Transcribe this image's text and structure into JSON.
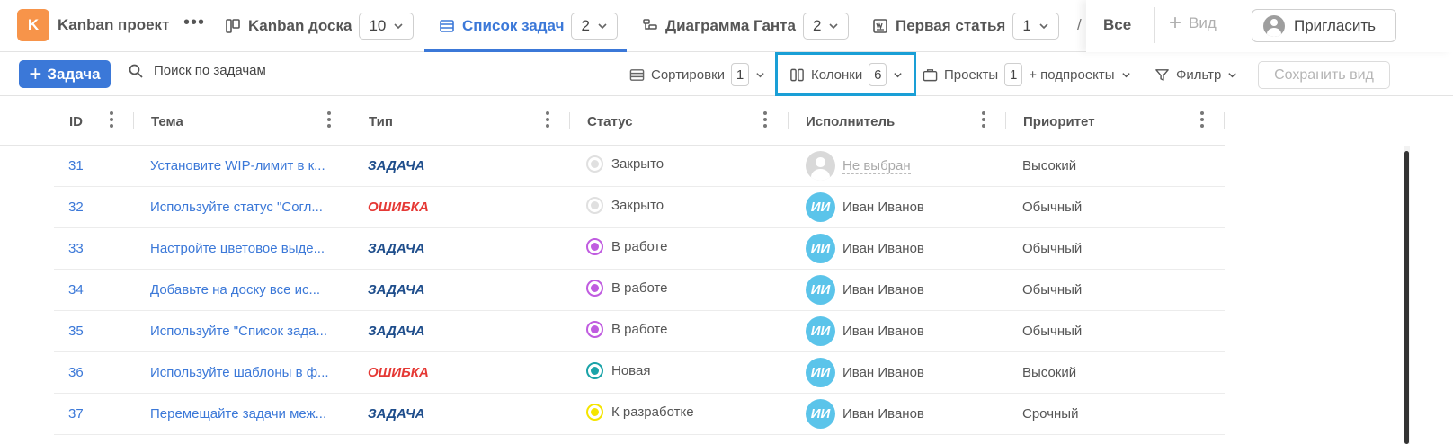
{
  "project": {
    "initial": "K",
    "name": "Kanban проект",
    "more": "•••"
  },
  "views": [
    {
      "label": "Kanban доска",
      "count": "10"
    },
    {
      "label": "Список задач",
      "count": "2"
    },
    {
      "label": "Диаграмма Ганта",
      "count": "2"
    },
    {
      "label": "Первая статья",
      "count": "1"
    }
  ],
  "topbar": {
    "cut_tab": "/",
    "all_label": "Все",
    "add_view_label": "Вид",
    "invite_label": "Пригласить"
  },
  "toolbar": {
    "new_task_label": "Задача",
    "search_placeholder": "Поиск по задачам",
    "sort_label": "Сортировки",
    "sort_count": "1",
    "columns_label": "Колонки",
    "columns_count": "6",
    "projects_label": "Проекты",
    "projects_count": "1",
    "subprojects_label": "+ подпроекты",
    "filter_label": "Фильтр",
    "save_view_label": "Сохранить вид"
  },
  "columns": [
    "ID",
    "Тема",
    "Тип",
    "Статус",
    "Исполнитель",
    "Приоритет"
  ],
  "colors": {
    "accent": "#3b78d8",
    "type_task": "#1f4e8c",
    "type_bug": "#e53935",
    "status_closed": "#e0e0e0",
    "status_in_progress": "#c05ce0",
    "status_new": "#1aa3a8",
    "status_todo": "#f5e500"
  },
  "rows": [
    {
      "id": "31",
      "subject": "Установите WIP-лимит в к...",
      "type": "ЗАДАЧА",
      "type_kind": "task",
      "status": "Закрыто",
      "status_kind": "closed",
      "assignee": "Не выбран",
      "assignee_initials": "",
      "priority": "Высокий"
    },
    {
      "id": "32",
      "subject": "Используйте статус \"Согл...",
      "type": "ОШИБКА",
      "type_kind": "bug",
      "status": "Закрыто",
      "status_kind": "closed",
      "assignee": "Иван Иванов",
      "assignee_initials": "ИИ",
      "priority": "Обычный"
    },
    {
      "id": "33",
      "subject": "Настройте цветовое выде...",
      "type": "ЗАДАЧА",
      "type_kind": "task",
      "status": "В работе",
      "status_kind": "in_progress",
      "assignee": "Иван Иванов",
      "assignee_initials": "ИИ",
      "priority": "Обычный"
    },
    {
      "id": "34",
      "subject": "Добавьте на доску все ис...",
      "type": "ЗАДАЧА",
      "type_kind": "task",
      "status": "В работе",
      "status_kind": "in_progress",
      "assignee": "Иван Иванов",
      "assignee_initials": "ИИ",
      "priority": "Обычный"
    },
    {
      "id": "35",
      "subject": "Используйте \"Список зада...",
      "type": "ЗАДАЧА",
      "type_kind": "task",
      "status": "В работе",
      "status_kind": "in_progress",
      "assignee": "Иван Иванов",
      "assignee_initials": "ИИ",
      "priority": "Обычный"
    },
    {
      "id": "36",
      "subject": "Используйте шаблоны в ф...",
      "type": "ОШИБКА",
      "type_kind": "bug",
      "status": "Новая",
      "status_kind": "new",
      "assignee": "Иван Иванов",
      "assignee_initials": "ИИ",
      "priority": "Высокий"
    },
    {
      "id": "37",
      "subject": "Перемещайте задачи меж...",
      "type": "ЗАДАЧА",
      "type_kind": "task",
      "status": "К разработке",
      "status_kind": "todo",
      "assignee": "Иван Иванов",
      "assignee_initials": "ИИ",
      "priority": "Срочный"
    }
  ]
}
